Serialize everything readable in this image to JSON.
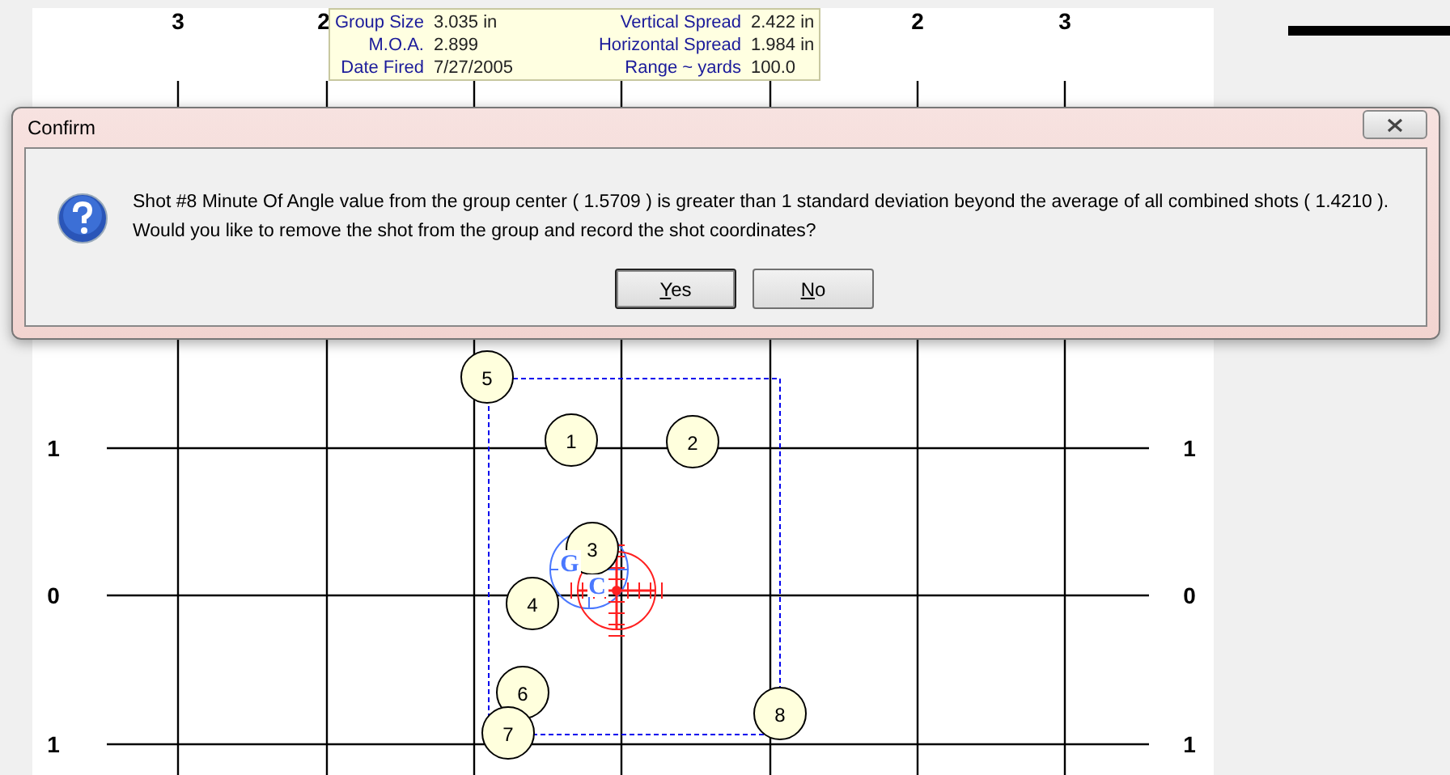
{
  "target": {
    "top_labels": [
      "3",
      "2",
      "2",
      "3"
    ],
    "left_labels": [
      "1",
      "0",
      "1"
    ],
    "right_labels": [
      "1",
      "0",
      "1"
    ],
    "shots": [
      {
        "label": "1"
      },
      {
        "label": "2"
      },
      {
        "label": "3"
      },
      {
        "label": "4"
      },
      {
        "label": "5"
      },
      {
        "label": "6"
      },
      {
        "label": "7"
      },
      {
        "label": "8"
      }
    ],
    "group_center_label": "G",
    "center_label": "C"
  },
  "stats": [
    {
      "label": "Group Size",
      "value": "3.035 in"
    },
    {
      "label": "Vertical Spread",
      "value": "2.422 in"
    },
    {
      "label": "M.O.A.",
      "value": "2.899"
    },
    {
      "label": "Horizontal Spread",
      "value": "1.984 in"
    },
    {
      "label": "Date Fired",
      "value": "7/27/2005"
    },
    {
      "label": "Range ~ yards",
      "value": "100.0"
    }
  ],
  "dialog": {
    "title": "Confirm",
    "message_lines": [
      "Shot #8 Minute Of Angle value from the group center ( 1.5709 ) is greater than 1 standard deviation beyond the average of all combined shots ( 1.4210 ).",
      "Would you like to remove the shot from the group and record the shot coordinates?"
    ],
    "buttons": [
      {
        "label": "Yes",
        "default": true
      },
      {
        "label": "No",
        "default": false
      }
    ]
  }
}
